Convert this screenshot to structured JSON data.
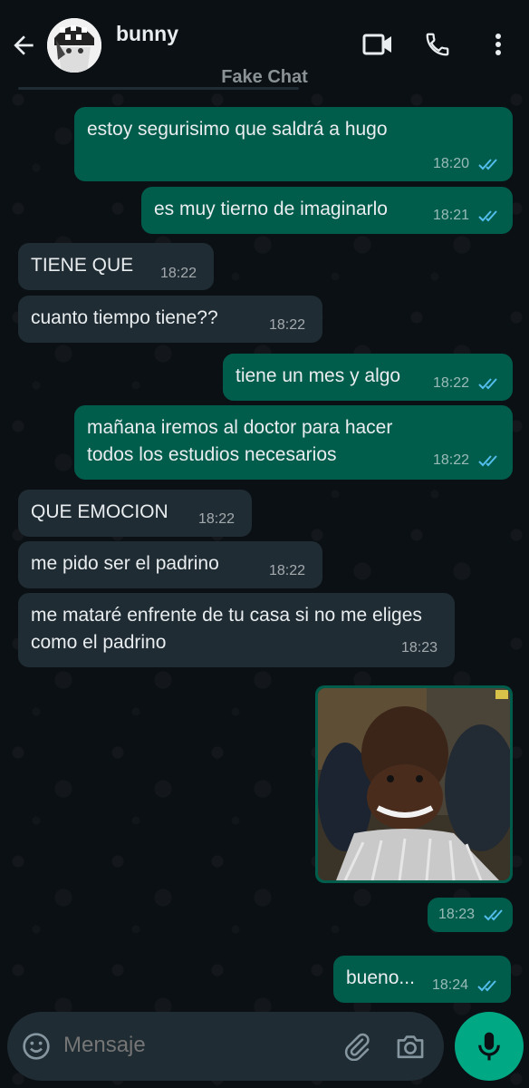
{
  "header": {
    "title": "bunny",
    "subtitle": "Fake Chat"
  },
  "messages": [
    {
      "dir": "out",
      "text": "estoy segurisimo que saldrá a hugo",
      "time": "18:20",
      "read": true
    },
    {
      "dir": "out",
      "text": "es muy tierno de imaginarlo",
      "time": "18:21",
      "read": true
    },
    {
      "dir": "in",
      "text": "TIENE QUE",
      "time": "18:22"
    },
    {
      "dir": "in",
      "text": "cuanto tiempo tiene??",
      "time": "18:22"
    },
    {
      "dir": "out",
      "text": "tiene un mes y algo",
      "time": "18:22",
      "read": true
    },
    {
      "dir": "out",
      "text": "mañana iremos al doctor para hacer todos los estudios necesarios",
      "time": "18:22",
      "read": true
    },
    {
      "dir": "in",
      "text": "QUE EMOCION",
      "time": "18:22"
    },
    {
      "dir": "in",
      "text": "me pido ser el padrino",
      "time": "18:22"
    },
    {
      "dir": "in",
      "text": "me mataré enfrente de tu casa si no me eliges como el padrino",
      "time": "18:23"
    },
    {
      "dir": "out",
      "type": "image",
      "time": "18:23",
      "read": true
    },
    {
      "dir": "out",
      "text": "bueno...",
      "time": "18:24",
      "read": true
    }
  ],
  "composer": {
    "placeholder": "Mensaje"
  },
  "colors": {
    "background": "#0b1014",
    "outgoing_bubble": "#005c4b",
    "incoming_bubble": "#1f2c33",
    "accent": "#00a884",
    "read_check": "#53bdeb"
  },
  "icons": [
    "back-arrow-icon",
    "video-call-icon",
    "phone-icon",
    "more-vert-icon",
    "emoji-icon",
    "attach-icon",
    "camera-icon",
    "mic-icon",
    "double-check-icon"
  ]
}
